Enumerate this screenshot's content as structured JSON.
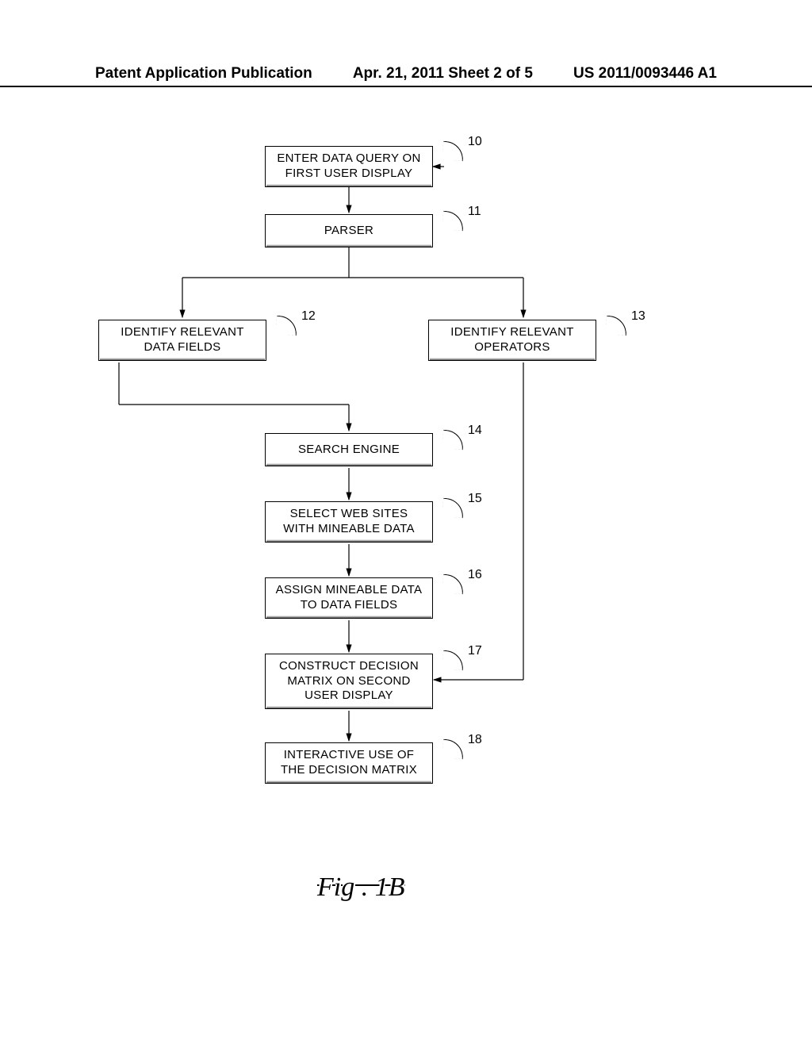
{
  "header": {
    "left": "Patent Application Publication",
    "center": "Apr. 21, 2011  Sheet 2 of 5",
    "right": "US 2011/0093446 A1"
  },
  "boxes": {
    "b10": "ENTER DATA QUERY ON\nFIRST USER DISPLAY",
    "b11": "PARSER",
    "b12": "IDENTIFY RELEVANT\nDATA FIELDS",
    "b13": "IDENTIFY RELEVANT\nOPERATORS",
    "b14": "SEARCH ENGINE",
    "b15": "SELECT WEB SITES\nWITH MINEABLE DATA",
    "b16": "ASSIGN MINEABLE DATA\nTO DATA FIELDS",
    "b17": "CONSTRUCT DECISION\nMATRIX ON SECOND\nUSER DISPLAY",
    "b18": "INTERACTIVE USE OF\nTHE DECISION MATRIX"
  },
  "refs": {
    "r10": "10",
    "r11": "11",
    "r12": "12",
    "r13": "13",
    "r14": "14",
    "r15": "15",
    "r16": "16",
    "r17": "17",
    "r18": "18"
  },
  "figure_label": "Fig . 1B",
  "chart_data": {
    "type": "flowchart",
    "nodes": [
      {
        "id": 10,
        "label": "ENTER DATA QUERY ON FIRST USER DISPLAY"
      },
      {
        "id": 11,
        "label": "PARSER"
      },
      {
        "id": 12,
        "label": "IDENTIFY RELEVANT DATA FIELDS"
      },
      {
        "id": 13,
        "label": "IDENTIFY RELEVANT OPERATORS"
      },
      {
        "id": 14,
        "label": "SEARCH ENGINE"
      },
      {
        "id": 15,
        "label": "SELECT WEB SITES WITH MINEABLE DATA"
      },
      {
        "id": 16,
        "label": "ASSIGN MINEABLE DATA TO DATA FIELDS"
      },
      {
        "id": 17,
        "label": "CONSTRUCT DECISION MATRIX ON SECOND USER DISPLAY"
      },
      {
        "id": 18,
        "label": "INTERACTIVE USE OF THE DECISION MATRIX"
      }
    ],
    "edges": [
      {
        "from": 10,
        "to": 11
      },
      {
        "from": 11,
        "to": 12
      },
      {
        "from": 11,
        "to": 13
      },
      {
        "from": 12,
        "to": 14
      },
      {
        "from": 14,
        "to": 15
      },
      {
        "from": 15,
        "to": 16
      },
      {
        "from": 16,
        "to": 17
      },
      {
        "from": 13,
        "to": 17
      },
      {
        "from": 17,
        "to": 18
      },
      {
        "from": 18,
        "to": 10,
        "feedback": true
      }
    ]
  }
}
